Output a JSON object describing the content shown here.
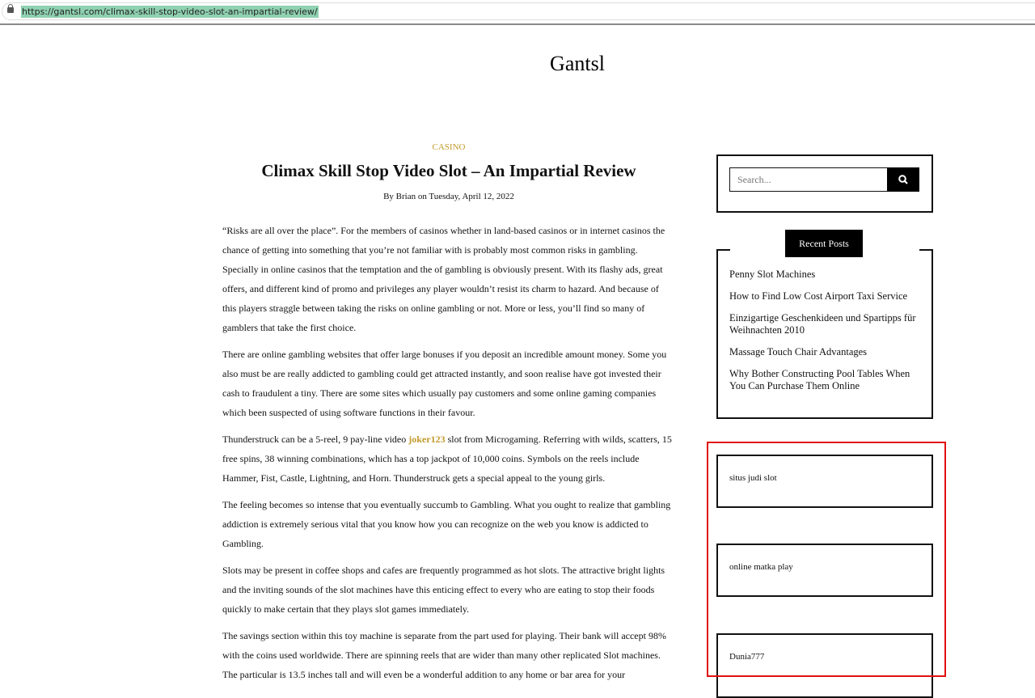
{
  "browser": {
    "url": "https://gantsl.com/climax-skill-stop-video-slot-an-impartial-review/"
  },
  "site": {
    "title": "Gantsl"
  },
  "post": {
    "category": "Casino",
    "title": "Climax Skill Stop Video Slot – An Impartial Review",
    "meta": "By Brian on Tuesday, April 12, 2022",
    "paragraphs": [
      "“Risks are all over the place”. For the members of casinos whether in land-based casinos or in internet casinos the chance of getting into something that you’re not familiar with is probably most common risks in gambling. Specially in online casinos that the temptation and the of gambling is obviously present. With its flashy ads, great offers, and different kind of promo and privileges any player wouldn’t resist its charm to hazard. And because of this players straggle between taking the risks on online gambling or not. More or less, you’ll find so many of gamblers that take the first choice.",
      "There are online gambling websites that offer large bonuses if you deposit an incredible amount money. Some you also must be are really addicted to gambling could get attracted instantly, and soon realise have got invested their cash to fraudulent a tiny. There are some sites which usually pay customers and some online gaming companies which been suspected of using software functions in their favour."
    ],
    "p3_before": "Thunderstruck can be a 5-reel, 9 pay-line video ",
    "p3_link": "joker123",
    "p3_after": " slot from Microgaming. Referring with wilds, scatters, 15 free spins, 38 winning combinations, which has a top jackpot of 10,000 coins. Symbols on the reels include Hammer, Fist, Castle, Lightning, and Horn. Thunderstruck gets a special appeal to the young girls.",
    "paragraphs_after": [
      "The feeling becomes so intense that you eventually succumb to Gambling. What you ought to realize that gambling addiction is extremely serious vital that you know how you can recognize on the web you know is addicted to Gambling.",
      "Slots may be present in coffee shops and cafes are frequently programmed as hot slots. The attractive bright lights and the inviting sounds of the slot machines have this enticing effect to every who are eating to stop their foods quickly to make certain that they plays slot games immediately.",
      "The savings section within this toy machine is separate from the part used for playing. Their bank will accept 98% with the coins used worldwide. There are spinning reels that are wider than many other replicated Slot machines. The particular is 13.5 inches tall and will even be a wonderful addition to any home or bar area for your"
    ]
  },
  "sidebar": {
    "search_placeholder": "Search...",
    "search_icon": "search-icon",
    "recent_title": "Recent Posts",
    "recent": [
      "Penny Slot Machines",
      "How to Find Low Cost Airport Taxi Service",
      "Einzigartige Geschenkideen und Spartipps für Weihnachten 2010",
      "Massage Touch Chair Advantages",
      "Why Bother Constructing Pool Tables When You Can Purchase Them Online"
    ],
    "widgets": [
      "situs judi slot",
      "online matka play",
      "Dunia777"
    ]
  },
  "colors": {
    "accent": "#c29a2b",
    "highlight": "#e01010"
  }
}
